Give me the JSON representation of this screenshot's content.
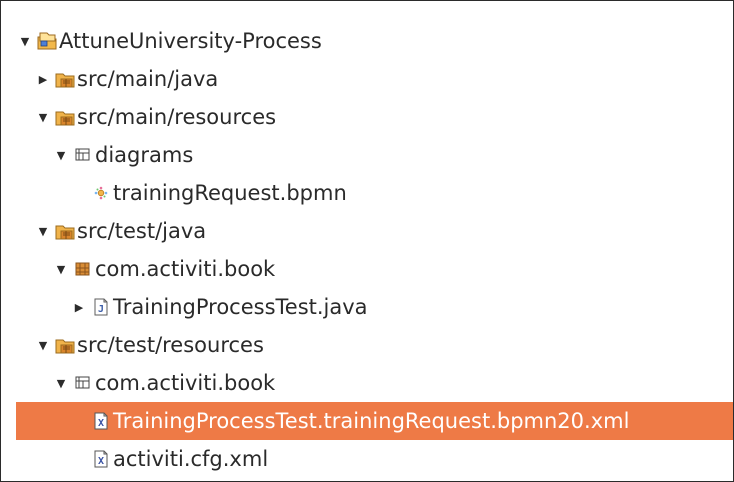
{
  "tree": {
    "items": [
      {
        "label": "AttuneUniversity-Process",
        "expanded": true,
        "icon": "project-icon"
      },
      {
        "label": "src/main/java",
        "expanded": false,
        "icon": "source-folder-icon"
      },
      {
        "label": "src/main/resources",
        "expanded": true,
        "icon": "source-folder-icon"
      },
      {
        "label": "diagrams",
        "expanded": true,
        "icon": "package-icon"
      },
      {
        "label": "trainingRequest.bpmn",
        "expanded": null,
        "icon": "bpmn-file-icon"
      },
      {
        "label": "src/test/java",
        "expanded": true,
        "icon": "source-folder-icon"
      },
      {
        "label": "com.activiti.book",
        "expanded": true,
        "icon": "package-icon"
      },
      {
        "label": "TrainingProcessTest.java",
        "expanded": false,
        "icon": "java-file-icon"
      },
      {
        "label": "src/test/resources",
        "expanded": true,
        "icon": "source-folder-icon"
      },
      {
        "label": "com.activiti.book",
        "expanded": true,
        "icon": "package-icon"
      },
      {
        "label": "TrainingProcessTest.trainingRequest.bpmn20.xml",
        "expanded": null,
        "icon": "xml-file-icon",
        "selected": true
      },
      {
        "label": "activiti.cfg.xml",
        "expanded": null,
        "icon": "xml-file-icon"
      }
    ]
  },
  "colors": {
    "selection": "#ee7a46",
    "folder": "#e9a73b",
    "package": "#8f5a2a"
  },
  "glyphs": {
    "expanded": "▼",
    "collapsed": "▶"
  }
}
